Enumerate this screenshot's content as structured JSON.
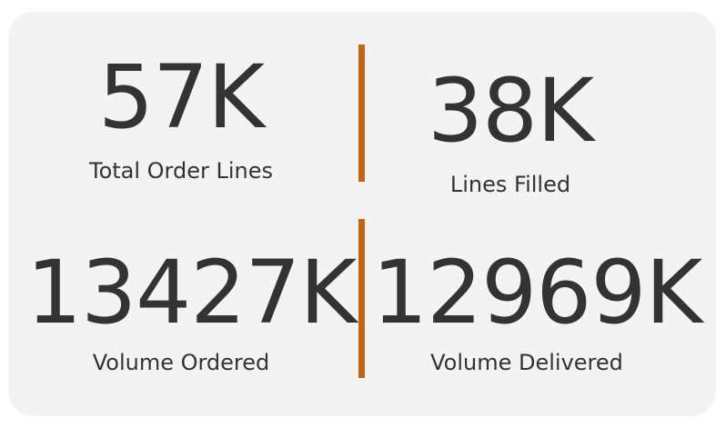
{
  "kpis": [
    {
      "value": "57K",
      "label": "Total Order Lines"
    },
    {
      "value": "38K",
      "label": "Lines Filled"
    },
    {
      "value": "13427K",
      "label": "Volume Ordered"
    },
    {
      "value": "12969K",
      "label": "Volume Delivered"
    }
  ],
  "colors": {
    "card_background": "#f3f3f3",
    "text": "#333333",
    "divider": "#c0661a"
  }
}
